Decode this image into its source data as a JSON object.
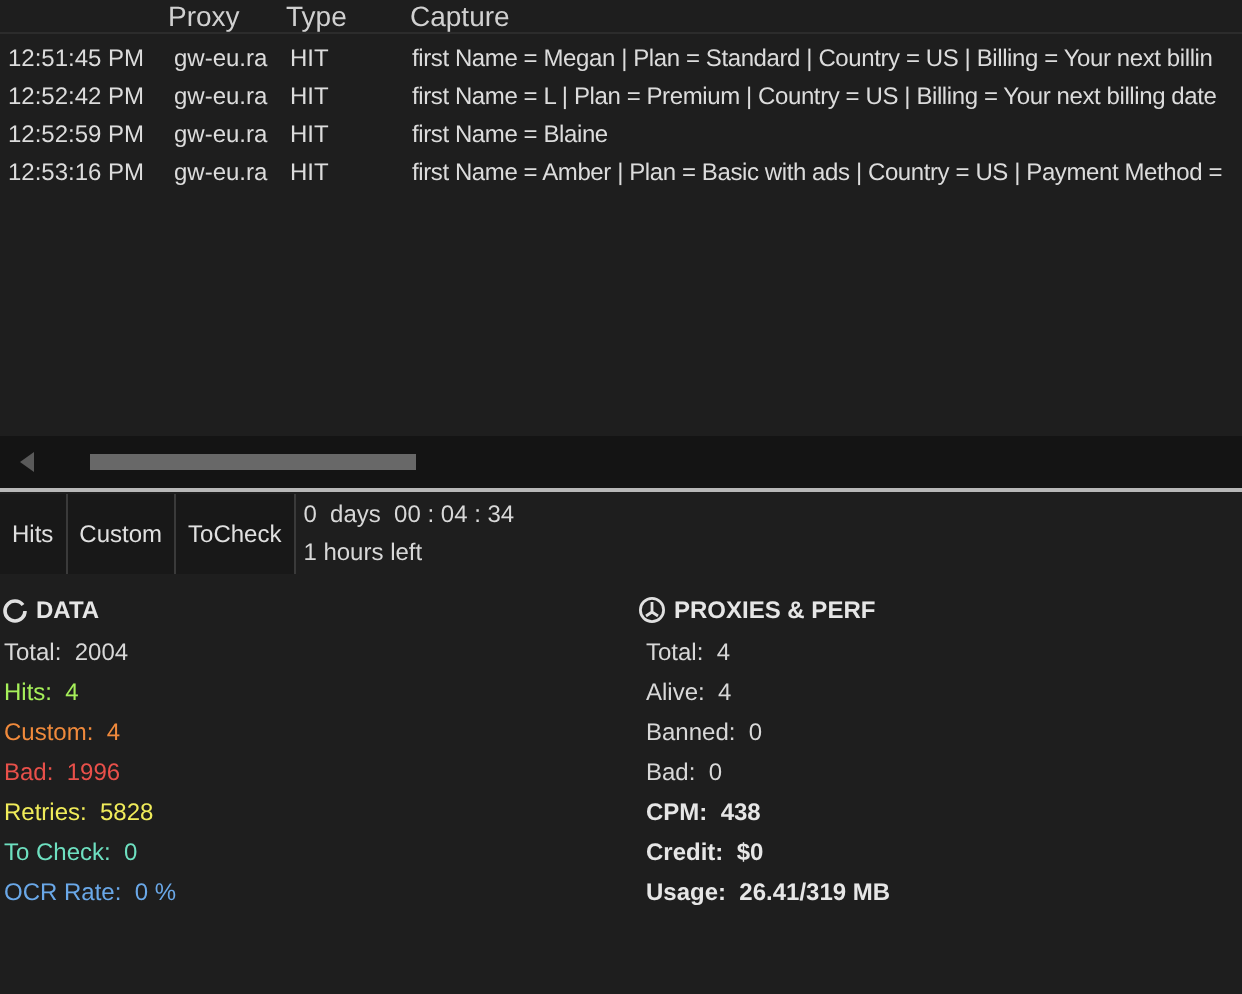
{
  "table": {
    "columns": [
      "Proxy",
      "Type",
      "Capture"
    ],
    "rows": [
      {
        "time": "12:51:45 PM",
        "proxy": "gw-eu.ra",
        "type": "HIT",
        "capture": "first Name = Megan | Plan = Standard | Country = US | Billing = Your next billin"
      },
      {
        "time": "12:52:42 PM",
        "proxy": "gw-eu.ra",
        "type": "HIT",
        "capture": "first Name = L | Plan = Premium | Country = US | Billing = Your next billing date"
      },
      {
        "time": "12:52:59 PM",
        "proxy": "gw-eu.ra",
        "type": "HIT",
        "capture": "first Name = Blaine"
      },
      {
        "time": "12:53:16 PM",
        "proxy": "gw-eu.ra",
        "type": "HIT",
        "capture": "first Name = Amber | Plan = Basic with ads | Country = US | Payment Method ="
      }
    ]
  },
  "tabs": [
    "Hits",
    "Custom",
    "ToCheck"
  ],
  "timer": {
    "elapsed": "0  days  00 : 04 : 34",
    "remaining": "1 hours left"
  },
  "data": {
    "title": "DATA",
    "items": [
      {
        "label": "Total:",
        "value": "2004",
        "color": "#d8d8d8"
      },
      {
        "label": "Hits:",
        "value": "4",
        "color": "#a6f05a"
      },
      {
        "label": "Custom:",
        "value": "4",
        "color": "#f08a3c"
      },
      {
        "label": "Bad:",
        "value": "1996",
        "color": "#e8504a"
      },
      {
        "label": "Retries:",
        "value": "5828",
        "color": "#f0ec5a"
      },
      {
        "label": "To Check:",
        "value": "0",
        "color": "#6ee0c0"
      },
      {
        "label": "OCR Rate:",
        "value": "0 %",
        "color": "#6aa8e8"
      }
    ]
  },
  "proxies": {
    "title": "PROXIES & PERF",
    "items": [
      {
        "label": "Total:",
        "value": "4",
        "kind": "plain"
      },
      {
        "label": "Alive:",
        "value": "4",
        "kind": "plain"
      },
      {
        "label": "Banned:",
        "value": "0",
        "kind": "plain"
      },
      {
        "label": "Bad:",
        "value": "0",
        "kind": "plain"
      },
      {
        "label": "CPM:",
        "value": "438",
        "kind": "strong"
      },
      {
        "label": "Credit:",
        "value": "$0",
        "kind": "strong"
      },
      {
        "label": "Usage:",
        "value": "26.41/319 MB",
        "kind": "strong"
      }
    ]
  }
}
